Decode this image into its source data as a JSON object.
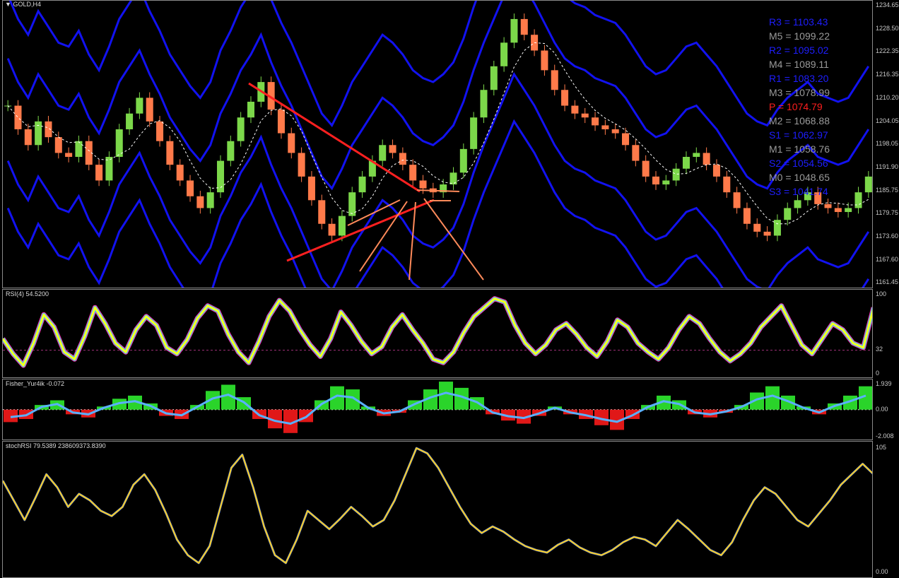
{
  "window": {
    "title": "GOLD,H4",
    "menu_icon": "triangle-down-icon"
  },
  "main_chart": {
    "price_ticks": [
      "1234.65",
      "1228.50",
      "1222.35",
      "1216.35",
      "1210.20",
      "1204.05",
      "1198.05",
      "1191.90",
      "1185.75",
      "1179.75",
      "1173.60",
      "1167.60",
      "1161.45"
    ],
    "pivots": [
      {
        "label": "R3 = 1103.43",
        "color": "#1e1eff"
      },
      {
        "label": "M5 = 1099.22",
        "color": "#9a9a9a"
      },
      {
        "label": "R2 = 1095.02",
        "color": "#1e1eff"
      },
      {
        "label": "M4 = 1089.11",
        "color": "#9a9a9a"
      },
      {
        "label": "R1 = 1083.20",
        "color": "#1e1eff"
      },
      {
        "label": "M3 = 1078.99",
        "color": "#9a9a9a"
      },
      {
        "label": "P   = 1074.79",
        "color": "#ff1e1e"
      },
      {
        "label": "M2 = 1068.88",
        "color": "#9a9a9a"
      },
      {
        "label": "S1 = 1062.97",
        "color": "#1e1eff"
      },
      {
        "label": "M1 = 1058.76",
        "color": "#9a9a9a"
      },
      {
        "label": "S2 = 1054.56",
        "color": "#1e1eff"
      },
      {
        "label": "M0 = 1048.65",
        "color": "#9a9a9a"
      },
      {
        "label": "S3 = 1041.74",
        "color": "#1e1eff"
      }
    ],
    "colors": {
      "bull": "#7cd84a",
      "bear": "#ff7a4a",
      "band": "#1212f0",
      "trend": "#ff2020",
      "arrow": "#ff8a5a"
    }
  },
  "rsi": {
    "title": "RSI(4) 54.5200",
    "ticks": [
      "100",
      "32",
      "0"
    ]
  },
  "fisher": {
    "title": "Fisher_Yur4ik -0.072",
    "ticks": [
      "1.939",
      "0.00",
      "-2.008"
    ]
  },
  "stochrsi": {
    "title": "stochRSI 79.5389 238609373.8390",
    "ticks": [
      "105",
      "0.00"
    ]
  },
  "chart_data": [
    {
      "type": "candlestick",
      "title": "GOLD,H4",
      "ylim": [
        1161.45,
        1234.65
      ],
      "series": [
        {
          "name": "GOLD,H4",
          "values": [
            1208,
            1202,
            1198,
            1204,
            1200,
            1196,
            1195,
            1199,
            1193,
            1189,
            1195,
            1202,
            1206,
            1210,
            1204,
            1199,
            1193,
            1189,
            1185,
            1182,
            1186,
            1194,
            1199,
            1205,
            1209,
            1214,
            1207,
            1201,
            1196,
            1190,
            1184,
            1178,
            1175,
            1180,
            1186,
            1190,
            1194,
            1198,
            1196,
            1193,
            1189,
            1187,
            1186,
            1188,
            1191,
            1197,
            1205,
            1212,
            1218,
            1224,
            1230,
            1226,
            1222,
            1217,
            1212,
            1208,
            1206,
            1205,
            1203,
            1202,
            1201,
            1198,
            1194,
            1190,
            1188,
            1189,
            1192,
            1195,
            1196,
            1193,
            1190,
            1186,
            1182,
            1178,
            1176,
            1175,
            1179,
            1182,
            1184,
            1186,
            1183,
            1182,
            1181,
            1182,
            1186,
            1190
          ]
        }
      ]
    },
    {
      "type": "line",
      "title": "RSI(4) 54.5200",
      "ylim": [
        0,
        100
      ],
      "series": [
        {
          "name": "RSI(4)",
          "values": [
            45,
            28,
            15,
            40,
            72,
            58,
            30,
            22,
            48,
            80,
            62,
            40,
            30,
            55,
            70,
            60,
            35,
            28,
            44,
            68,
            82,
            76,
            50,
            30,
            18,
            42,
            70,
            88,
            76,
            55,
            38,
            25,
            45,
            75,
            60,
            42,
            28,
            36,
            58,
            72,
            55,
            40,
            22,
            18,
            30,
            52,
            70,
            80,
            90,
            86,
            60,
            40,
            28,
            38,
            55,
            62,
            50,
            35,
            25,
            42,
            66,
            58,
            40,
            30,
            22,
            35,
            55,
            70,
            62,
            45,
            30,
            20,
            28,
            40,
            58,
            70,
            82,
            60,
            38,
            28,
            45,
            62,
            55,
            40,
            35,
            80
          ]
        }
      ]
    },
    {
      "type": "bar",
      "title": "Fisher_Yur4ik -0.072",
      "ylim": [
        -2.008,
        1.939
      ],
      "series": [
        {
          "name": "Fisher_Yur4ik",
          "values": [
            -0.8,
            -0.6,
            0.3,
            0.6,
            -0.3,
            -0.5,
            0.2,
            0.7,
            0.9,
            0.4,
            -0.4,
            -0.6,
            0.3,
            1.2,
            1.6,
            0.8,
            -0.6,
            -1.2,
            -1.5,
            -0.8,
            0.6,
            1.5,
            1.3,
            0.2,
            -0.4,
            -0.2,
            0.6,
            1.3,
            1.8,
            1.4,
            0.8,
            -0.3,
            -0.7,
            -0.9,
            -0.4,
            0.2,
            -0.3,
            -0.6,
            -1.0,
            -1.3,
            -0.6,
            0.3,
            0.9,
            0.6,
            -0.3,
            -0.5,
            -0.2,
            0.3,
            1.1,
            1.5,
            0.9,
            0.2,
            -0.3,
            0.4,
            0.9,
            1.5
          ]
        }
      ]
    },
    {
      "type": "line",
      "title": "stochRSI 79.5389 238609373.8390",
      "ylim": [
        0,
        105
      ],
      "series": [
        {
          "name": "stochRSI",
          "values": [
            75,
            60,
            45,
            62,
            80,
            70,
            55,
            65,
            60,
            52,
            48,
            55,
            72,
            80,
            68,
            50,
            30,
            18,
            12,
            25,
            55,
            85,
            95,
            70,
            40,
            18,
            12,
            30,
            52,
            45,
            38,
            46,
            55,
            48,
            40,
            45,
            60,
            80,
            100,
            96,
            85,
            70,
            55,
            42,
            35,
            40,
            36,
            30,
            25,
            22,
            20,
            26,
            30,
            24,
            20,
            18,
            22,
            28,
            32,
            30,
            25,
            35,
            45,
            38,
            30,
            22,
            18,
            28,
            45,
            60,
            70,
            65,
            55,
            45,
            40,
            50,
            60,
            72,
            80,
            88,
            80
          ]
        }
      ]
    }
  ]
}
